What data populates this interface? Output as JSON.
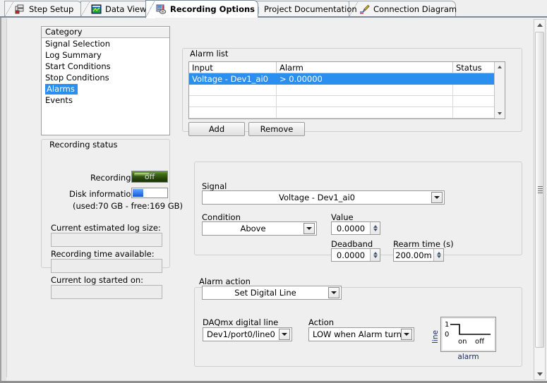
{
  "tabs": [
    {
      "label": "Step Setup",
      "icon": "step-setup-icon",
      "active": false
    },
    {
      "label": "Data View",
      "icon": "data-view-icon",
      "active": false
    },
    {
      "label": "Recording Options",
      "icon": "recording-options-icon",
      "active": true
    },
    {
      "label": "Project Documentation",
      "icon": "document-icon",
      "active": false
    },
    {
      "label": "Connection Diagram",
      "icon": "connection-diagram-icon",
      "active": false
    }
  ],
  "category": {
    "header": "Category",
    "items": [
      "Signal Selection",
      "Log Summary",
      "Start Conditions",
      "Stop Conditions",
      "Alarms",
      "Events"
    ],
    "selected": "Alarms"
  },
  "recording_status": {
    "title": "Recording status",
    "recording_label": "Recording",
    "recording_value": "off",
    "disk_label": "Disk information",
    "disk_usage_text": "(used:70 GB - free:169 GB)",
    "disk_used_percent": 30,
    "est_log_size_label": "Current estimated log size:",
    "est_log_size_value": "",
    "time_available_label": "Recording time available:",
    "time_available_value": "",
    "log_started_label": "Current log started on:",
    "log_started_value": ""
  },
  "alarm_list": {
    "title": "Alarm list",
    "columns": [
      "Input",
      "Alarm",
      "Status"
    ],
    "rows": [
      {
        "input": "Voltage - Dev1_ai0",
        "alarm": "> 0.00000",
        "status": "",
        "selected": true
      },
      {
        "input": "",
        "alarm": "",
        "status": "",
        "selected": false
      },
      {
        "input": "",
        "alarm": "",
        "status": "",
        "selected": false
      },
      {
        "input": "",
        "alarm": "",
        "status": "",
        "selected": false
      }
    ],
    "add_label": "Add",
    "remove_label": "Remove"
  },
  "alarm_config": {
    "signal_label": "Signal",
    "signal_value": "Voltage - Dev1_ai0",
    "condition_label": "Condition",
    "condition_value": "Above",
    "value_label": "Value",
    "value_value": "0.0000",
    "deadband_label": "Deadband",
    "deadband_value": "0.0000",
    "rearm_label": "Rearm time (s)",
    "rearm_value": "200.00m"
  },
  "alarm_action": {
    "title": "Alarm action",
    "action_type_value": "Set Digital Line",
    "digital_line_label": "DAQmx digital line",
    "digital_line_value": "Dev1/port0/line0",
    "action_label": "Action",
    "action_value": "LOW when Alarm turns",
    "graph": {
      "y_axis_label": "line",
      "x_axis_label": "alarm",
      "y_ticks": [
        "1",
        "0"
      ],
      "x_ticks": [
        "on",
        "off"
      ]
    }
  },
  "colors": {
    "selection": "#2a8fee",
    "indicator_off": "#3f6b17",
    "disk_fill": "#1558d6",
    "tab_border": "#7b8a99"
  }
}
